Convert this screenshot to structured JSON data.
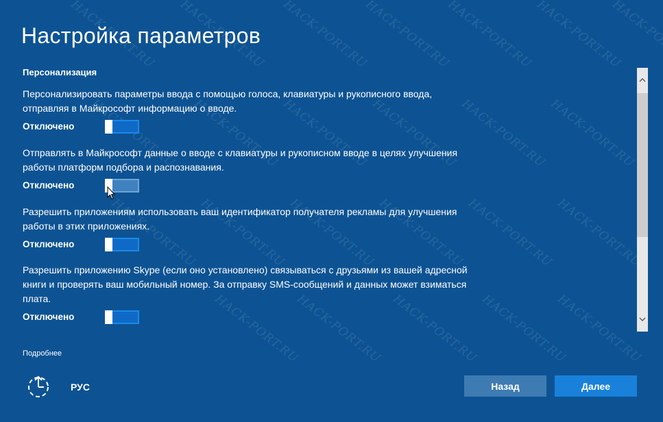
{
  "page": {
    "title": "Настройка параметров",
    "section_heading": "Персонализация"
  },
  "settings": [
    {
      "description": "Персонализировать параметры ввода с помощью голоса, клавиатуры и рукописного ввода, отправляя в Майкрософт информацию о вводе.",
      "state_label": "Отключено",
      "value": "off"
    },
    {
      "description": "Отправлять в Майкрософт данные о вводе с клавиатуры и рукописном вводе в целях улучшения работы платформ подбора и распознавания.",
      "state_label": "Отключено",
      "value": "off"
    },
    {
      "description": "Разрешить приложениям использовать ваш идентификатор получателя рекламы для улучшения работы в этих приложениях.",
      "state_label": "Отключено",
      "value": "off"
    },
    {
      "description": "Разрешить приложению Skype (если оно установлено) связываться с друзьями из вашей адресной книги и проверять ваш мобильный номер. За отправку SMS-сообщений и данных может взиматься плата.",
      "state_label": "Отключено",
      "value": "off"
    }
  ],
  "footer": {
    "more_link": "Подробнее",
    "language": "РУС",
    "back_button": "Назад",
    "next_button": "Далее",
    "accessibility_icon": "ease-of-access-icon"
  },
  "watermark": {
    "text": "HACK-PORT.RU"
  },
  "colors": {
    "background": "#0d5393",
    "toggle_on_track": "#0e6ac6",
    "toggle_border": "#1a8ae8",
    "back_button": "#3e7bb3",
    "next_button": "#1981da",
    "scrollbar": "#e8e8e8",
    "scroll_thumb": "#cdcdcd"
  }
}
